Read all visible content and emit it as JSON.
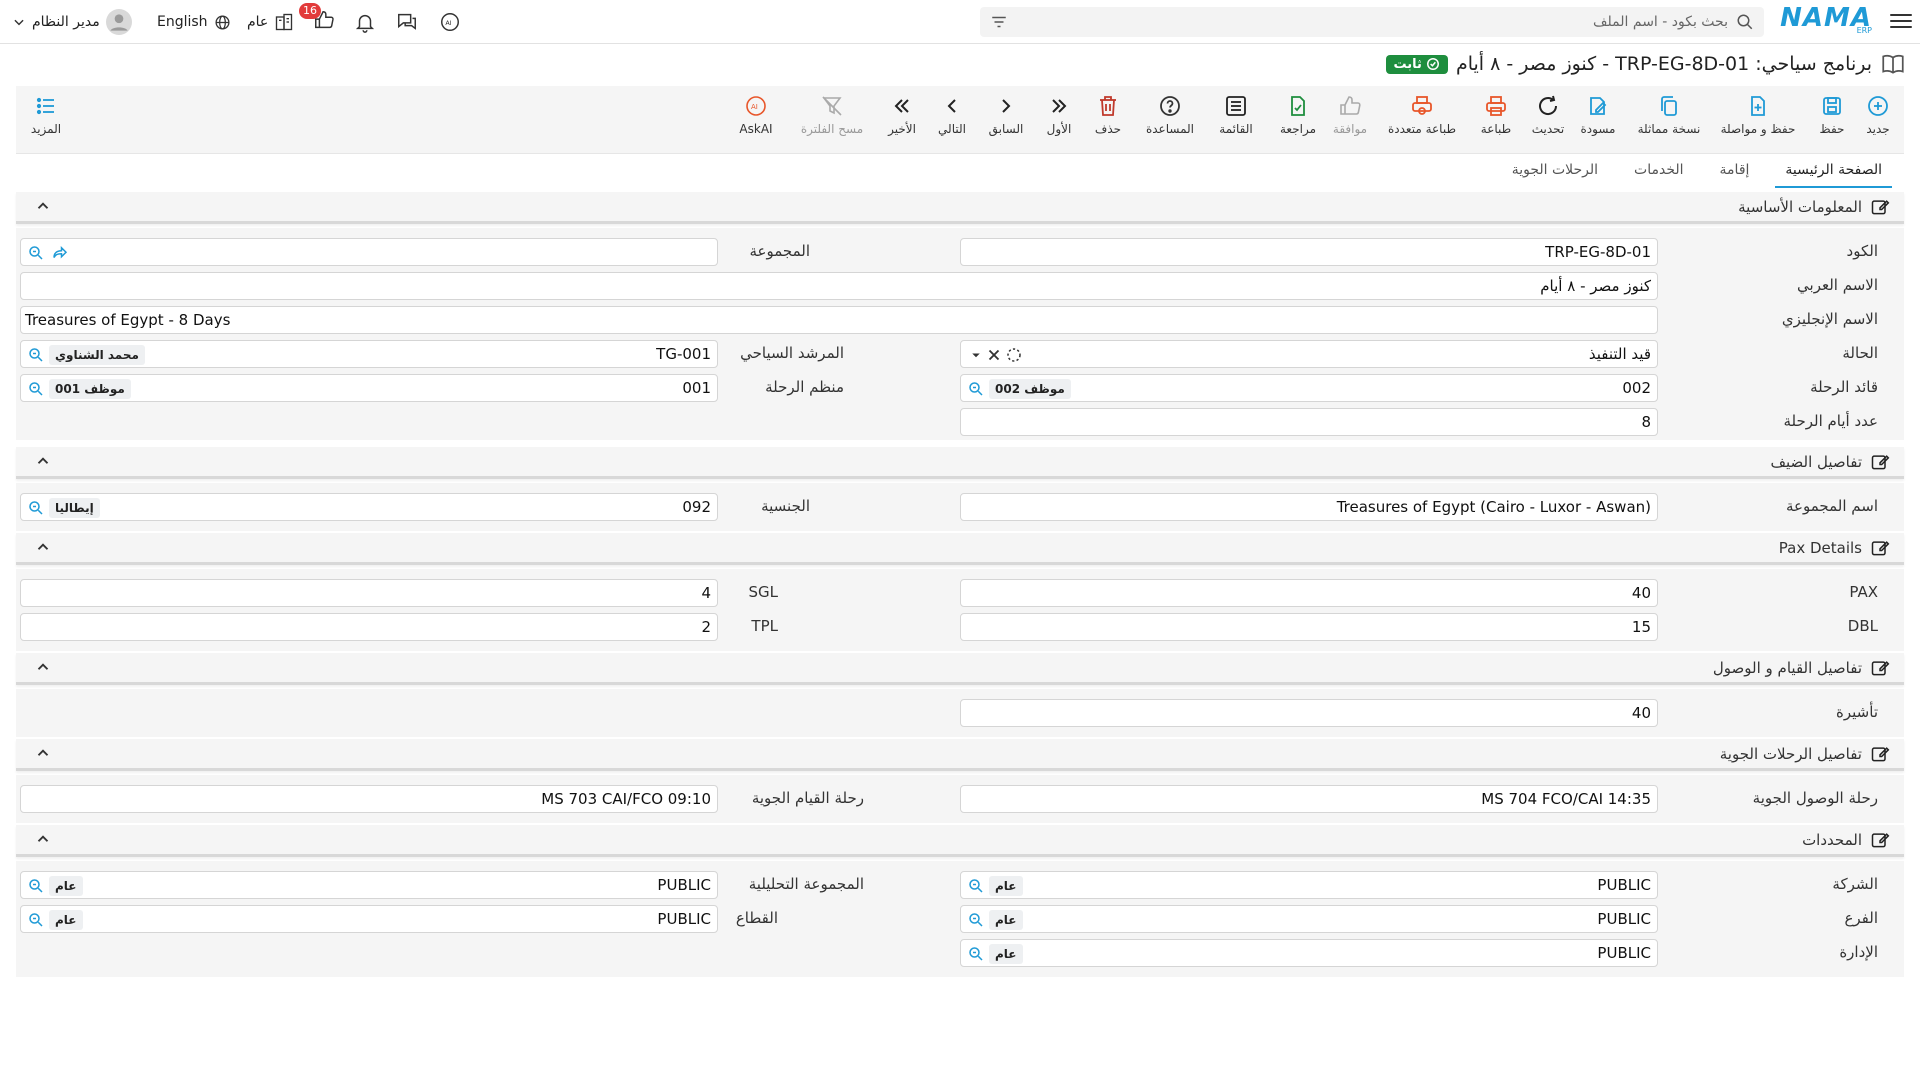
{
  "topbar": {
    "logo_text": "NAMA",
    "logo_sub": "ERP",
    "search_placeholder": "بحث بكود - اسم الملف",
    "user_name": "مدير النظام",
    "language": "English",
    "notifications_badge": "16",
    "public_label": "عام"
  },
  "title": {
    "text": "برنامج سياحي: TRP-EG-8D-01 - كنوز مصر - ٨ أيام",
    "status": "ثابت"
  },
  "toolbar": {
    "new": "جديد",
    "save": "حفظ",
    "save_continue": "حفظ و مواصلة",
    "duplicate": "نسخة مماثلة",
    "draft": "مسودة",
    "refresh": "تحديث",
    "print": "طباعة",
    "multi_print": "طباعة متعددة",
    "approve": "موافقة",
    "review": "مراجعة",
    "list": "القائمة",
    "help": "المساعدة",
    "delete": "حذف",
    "first": "الأول",
    "previous": "السابق",
    "next": "التالي",
    "last": "الأخير",
    "clear_filter": "مسح الفلترة",
    "askai": "AskAI",
    "more": "المزيد"
  },
  "tabs": [
    "الصفحة الرئيسية",
    "إقامة",
    "الخدمات",
    "الرحلات الجوية"
  ],
  "sections": {
    "basic": {
      "title": "المعلومات الأساسية",
      "code_label": "الكود",
      "code": "TRP-EG-8D-01",
      "group_label": "المجموعة",
      "group": "",
      "arabic_name_label": "الاسم العربي",
      "arabic_name": "كنوز مصر - ٨ أيام",
      "english_name_label": "الاسم الإنجليزي",
      "english_name": "Treasures of Egypt - 8 Days",
      "status_label": "الحالة",
      "status": "قيد التنفيذ",
      "guide_label": "المرشد السياحي",
      "guide_code": "TG-001",
      "guide_name": "محمد الشناوي",
      "leader_label": "قائد الرحلة",
      "leader_code": "002",
      "leader_name": "موظف 002",
      "organizer_label": "منظم الرحلة",
      "organizer_code": "001",
      "organizer_name": "موظف 001",
      "days_label": "عدد أيام الرحلة",
      "days": "8"
    },
    "guest": {
      "title": "تفاصيل الضيف",
      "group_name_label": "اسم المجموعة",
      "group_name": "Treasures of Egypt (Cairo - Luxor - Aswan)",
      "nationality_label": "الجنسية",
      "nationality_code": "092",
      "nationality_name": "إيطاليا"
    },
    "pax": {
      "title": "Pax Details",
      "pax_label": "PAX",
      "pax": "40",
      "sgl_label": "SGL",
      "sgl": "4",
      "dbl_label": "DBL",
      "dbl": "15",
      "tpl_label": "TPL",
      "tpl": "2"
    },
    "arrival": {
      "title": "تفاصيل القيام و الوصول",
      "visa_label": "تأشيرة",
      "visa": "40"
    },
    "flights": {
      "title": "تفاصيل الرحلات الجوية",
      "arrival_label": "رحلة الوصول الجوية",
      "arrival": "MS 704 FCO/CAI 14:35",
      "departure_label": "رحلة القيام الجوية",
      "departure": "MS 703 CAI/FCO 09:10"
    },
    "dimensions": {
      "title": "المحددات",
      "company_label": "الشركة",
      "company": "PUBLIC",
      "company_chip": "عام",
      "analytic_label": "المجموعة التحليلية",
      "analytic": "PUBLIC",
      "analytic_chip": "عام",
      "branch_label": "الفرع",
      "branch": "PUBLIC",
      "branch_chip": "عام",
      "sector_label": "القطاع",
      "sector": "PUBLIC",
      "sector_chip": "عام",
      "department_label": "الإدارة",
      "department": "PUBLIC",
      "department_chip": "عام"
    }
  },
  "colors": {
    "accent": "#1f9ad6",
    "status_green": "#1e8e3e",
    "delete_red": "#c0392b",
    "print_orange": "#e8562a"
  }
}
